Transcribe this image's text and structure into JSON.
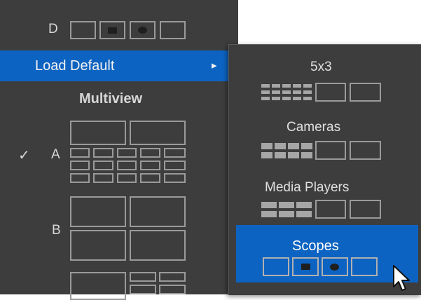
{
  "main_menu": {
    "row_d_letter": "D",
    "load_default": {
      "label": "Load Default",
      "arrow": "▸"
    },
    "multiview_header": "Multiview",
    "layout_a": {
      "letter": "A",
      "checkmark": "✓",
      "checked": true
    },
    "layout_b": {
      "letter": "B"
    }
  },
  "submenu": {
    "items": [
      {
        "label": "5x3"
      },
      {
        "label": "Cameras"
      },
      {
        "label": "Media Players"
      },
      {
        "label": "Scopes",
        "highlighted": true
      }
    ]
  },
  "colors": {
    "menu_bg": "#3d3d3d",
    "highlight": "#0d63c1",
    "icon_outline": "#9a9a9a"
  },
  "cursor": {
    "icon": "mouse-pointer-icon"
  }
}
